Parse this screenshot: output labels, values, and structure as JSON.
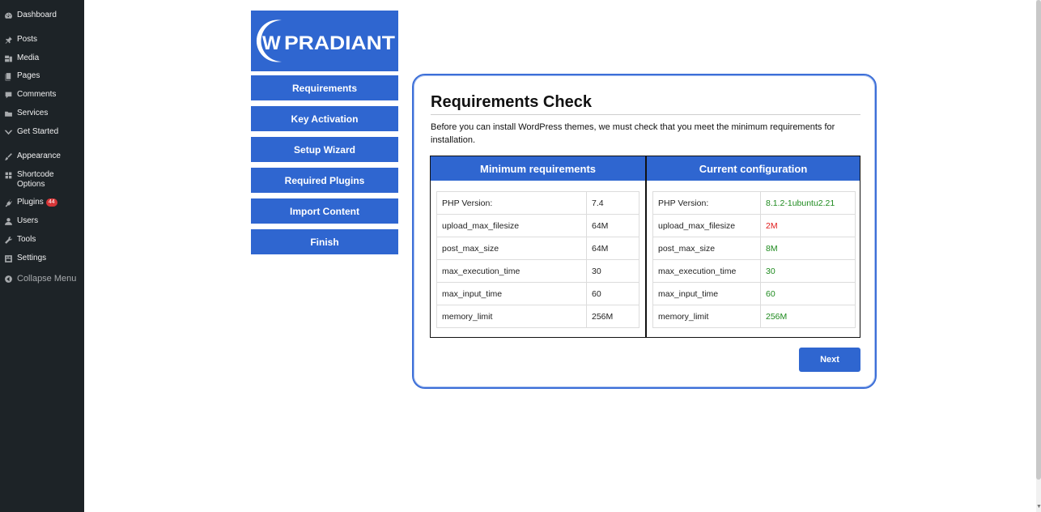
{
  "sidebar": {
    "items": [
      {
        "label": "Dashboard",
        "icon": "dashboard-icon"
      },
      {
        "label": "Posts",
        "icon": "pin-icon"
      },
      {
        "label": "Media",
        "icon": "media-icon"
      },
      {
        "label": "Pages",
        "icon": "pages-icon"
      },
      {
        "label": "Comments",
        "icon": "comment-icon"
      },
      {
        "label": "Services",
        "icon": "folder-icon"
      },
      {
        "label": "Get Started",
        "icon": "chevron-icon"
      },
      {
        "label": "Appearance",
        "icon": "brush-icon"
      },
      {
        "label": "Shortcode\nOptions",
        "icon": "grid-icon"
      },
      {
        "label": "Plugins",
        "icon": "plug-icon",
        "badge": "44"
      },
      {
        "label": "Users",
        "icon": "user-icon"
      },
      {
        "label": "Tools",
        "icon": "wrench-icon"
      },
      {
        "label": "Settings",
        "icon": "settings-icon"
      }
    ],
    "collapse_label": "Collapse Menu"
  },
  "logo": {
    "text": "WPRADIANT",
    "initial": "W",
    "rest": "PRADIANT"
  },
  "wizard_steps": [
    "Requirements",
    "Key Activation",
    "Setup Wizard",
    "Required Plugins",
    "Import Content",
    "Finish"
  ],
  "card": {
    "title": "Requirements Check",
    "description": "Before you can install WordPress themes, we must check that you meet the minimum requirements for installation.",
    "min_header": "Minimum requirements",
    "cur_header": "Current configuration",
    "rows": [
      {
        "key": "PHP Version:",
        "min": "7.4",
        "cur": "8.1.2-1ubuntu2.21",
        "ok": true
      },
      {
        "key": "upload_max_filesize",
        "min": "64M",
        "cur": "2M",
        "ok": false
      },
      {
        "key": "post_max_size",
        "min": "64M",
        "cur": "8M",
        "ok": true
      },
      {
        "key": "max_execution_time",
        "min": "30",
        "cur": "30",
        "ok": true
      },
      {
        "key": "max_input_time",
        "min": "60",
        "cur": "60",
        "ok": true
      },
      {
        "key": "memory_limit",
        "min": "256M",
        "cur": "256M",
        "ok": true
      }
    ],
    "next_label": "Next"
  },
  "colors": {
    "brand": "#2f66d0",
    "ok": "#1e8a1e",
    "bad": "#e01b1b",
    "sidebar_bg": "#1d2327"
  }
}
